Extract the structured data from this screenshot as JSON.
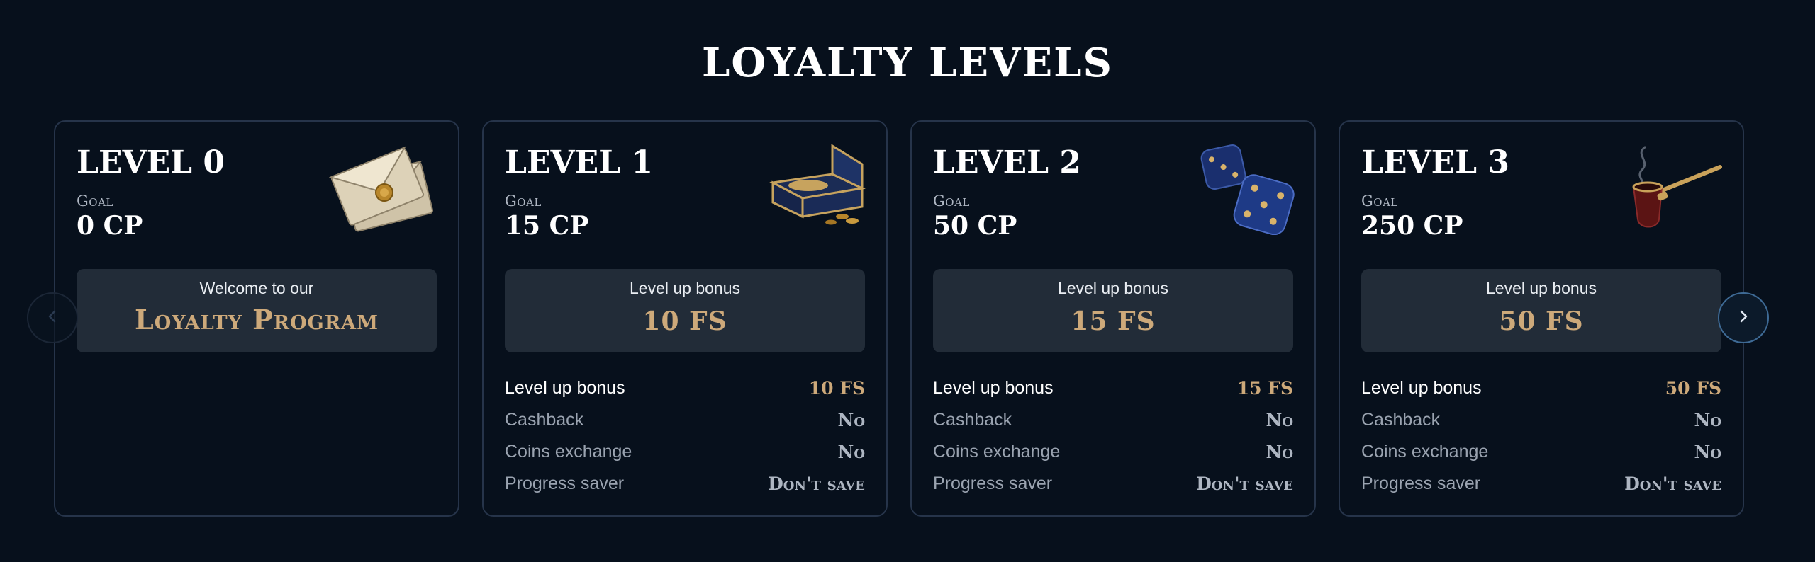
{
  "page": {
    "title": "LOYALTY LEVELS"
  },
  "nav": {
    "prev_icon": "chevron-left-icon",
    "next_icon": "chevron-right-icon"
  },
  "colors": {
    "background": "#07101c",
    "accent_gold": "#cda97a",
    "card_border": "#26344a",
    "box_bg": "#222c38"
  },
  "cards": [
    {
      "level": "LEVEL 0",
      "goal_label": "Goal",
      "goal_value": "0 CP",
      "icon": "envelope-icon",
      "bonus_caption": "Welcome to our",
      "bonus_value": "Loyalty Program"
    },
    {
      "level": "LEVEL 1",
      "goal_label": "Goal",
      "goal_value": "15 CP",
      "icon": "treasure-chest-icon",
      "bonus_caption": "Level up bonus",
      "bonus_value": "10 FS",
      "rows": [
        {
          "label": "Level up bonus",
          "value": "10 FS"
        },
        {
          "label": "Cashback",
          "value": "No"
        },
        {
          "label": "Coins exchange",
          "value": "No"
        },
        {
          "label": "Progress saver",
          "value": "Don't save"
        }
      ]
    },
    {
      "level": "LEVEL 2",
      "goal_label": "Goal",
      "goal_value": "50 CP",
      "icon": "dice-icon",
      "bonus_caption": "Level up bonus",
      "bonus_value": "15 FS",
      "rows": [
        {
          "label": "Level up bonus",
          "value": "15 FS"
        },
        {
          "label": "Cashback",
          "value": "No"
        },
        {
          "label": "Coins exchange",
          "value": "No"
        },
        {
          "label": "Progress saver",
          "value": "Don't save"
        }
      ]
    },
    {
      "level": "LEVEL 3",
      "goal_label": "Goal",
      "goal_value": "250 CP",
      "icon": "pipe-icon",
      "bonus_caption": "Level up bonus",
      "bonus_value": "50 FS",
      "rows": [
        {
          "label": "Level up bonus",
          "value": "50 FS"
        },
        {
          "label": "Cashback",
          "value": "No"
        },
        {
          "label": "Coins exchange",
          "value": "No"
        },
        {
          "label": "Progress saver",
          "value": "Don't save"
        }
      ]
    }
  ]
}
